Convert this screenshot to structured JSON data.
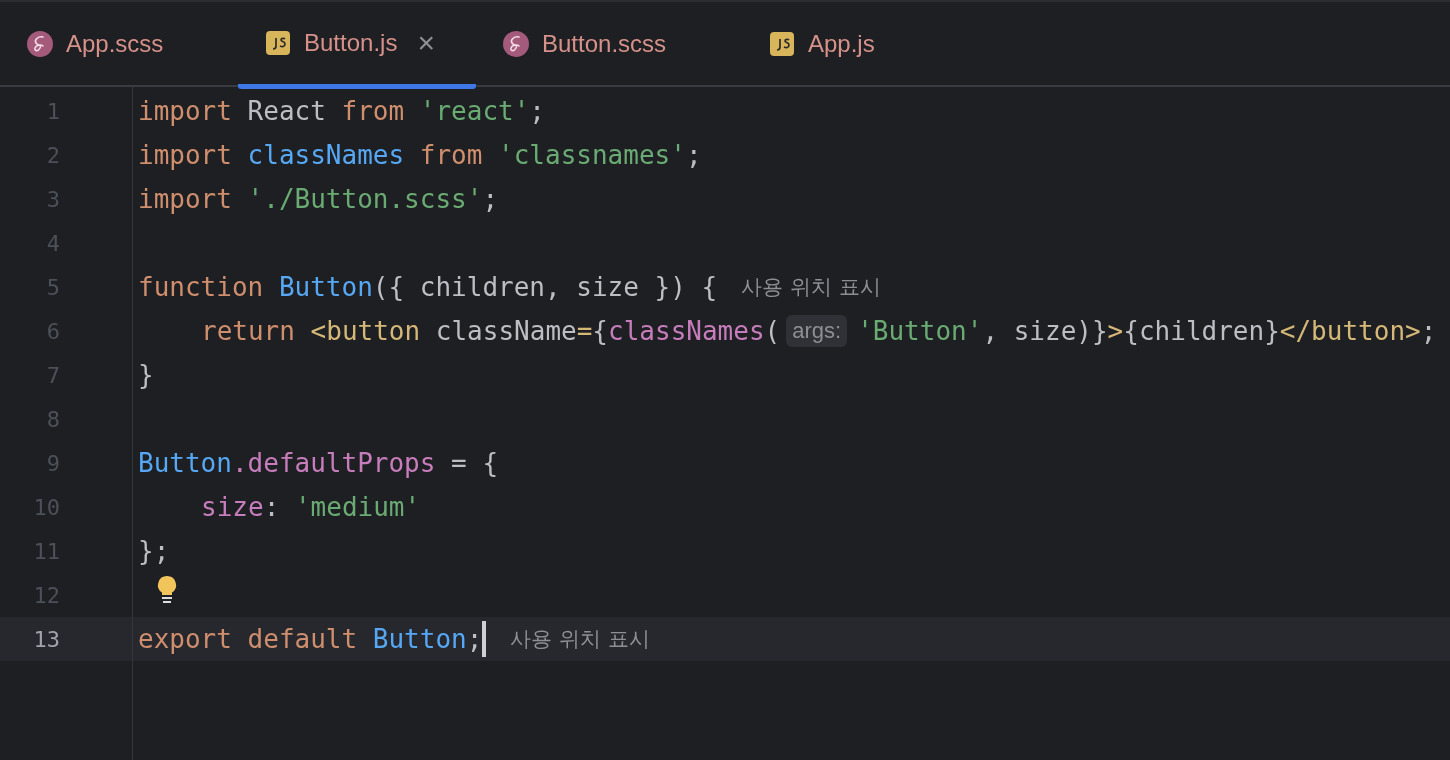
{
  "tabs": [
    {
      "label": "App.scss",
      "kind": "sass",
      "selected": false
    },
    {
      "label": "Button.js",
      "kind": "js",
      "selected": true
    },
    {
      "label": "Button.scss",
      "kind": "sass",
      "selected": false
    },
    {
      "label": "App.js",
      "kind": "js",
      "selected": false
    }
  ],
  "close_glyph": "×",
  "editor": {
    "lines": [
      {
        "number": "1",
        "current": false,
        "bulb": false,
        "caret": false,
        "indented": false,
        "segments": [
          {
            "kind": "code",
            "tokens": [
              {
                "kind": "kw",
                "s": "import "
              },
              {
                "kind": "id",
                "s": "React "
              },
              {
                "kind": "kw",
                "s": "from "
              },
              {
                "kind": "str",
                "s": "'react'"
              },
              {
                "kind": "id",
                "s": ";"
              }
            ]
          }
        ]
      },
      {
        "number": "2",
        "current": false,
        "bulb": false,
        "caret": false,
        "indented": false,
        "segments": [
          {
            "kind": "code",
            "tokens": [
              {
                "kind": "kw",
                "s": "import "
              },
              {
                "kind": "fn",
                "s": "classNames "
              },
              {
                "kind": "kw",
                "s": "from "
              },
              {
                "kind": "str",
                "s": "'classnames'"
              },
              {
                "kind": "id",
                "s": ";"
              }
            ]
          }
        ]
      },
      {
        "number": "3",
        "current": false,
        "bulb": false,
        "caret": false,
        "indented": false,
        "segments": [
          {
            "kind": "code",
            "tokens": [
              {
                "kind": "kw",
                "s": "import "
              },
              {
                "kind": "str",
                "s": "'./Button.scss'"
              },
              {
                "kind": "id",
                "s": ";"
              }
            ]
          }
        ]
      },
      {
        "number": "4",
        "current": false,
        "bulb": false,
        "caret": false
      },
      {
        "number": "5",
        "current": false,
        "bulb": false,
        "caret": false,
        "indented": false,
        "segments": [
          {
            "kind": "code",
            "tokens": [
              {
                "kind": "kw",
                "s": "function "
              },
              {
                "kind": "fn",
                "s": "Button"
              },
              {
                "kind": "id",
                "s": "({ children, size }) {"
              }
            ]
          },
          {
            "kind": "usage_hint",
            "text": "사용 위치 표시"
          }
        ]
      },
      {
        "number": "6",
        "current": false,
        "bulb": false,
        "caret": false,
        "indented": true,
        "segments": [
          {
            "kind": "code",
            "tokens": [
              {
                "kind": "kw",
                "s": "return "
              },
              {
                "kind": "tag",
                "s": "<button "
              },
              {
                "kind": "id",
                "s": "className"
              },
              {
                "kind": "tag",
                "s": "="
              },
              {
                "kind": "id",
                "s": "{"
              },
              {
                "kind": "prop",
                "s": "classNames"
              },
              {
                "kind": "id",
                "s": "("
              }
            ]
          },
          {
            "kind": "param_hint",
            "text": "args:"
          },
          {
            "kind": "code",
            "tokens": [
              {
                "kind": "str",
                "s": "'Button'"
              },
              {
                "kind": "id",
                "s": ", size)}"
              },
              {
                "kind": "tag",
                "s": ">"
              },
              {
                "kind": "id",
                "s": "{children}"
              },
              {
                "kind": "tag",
                "s": "</button>"
              },
              {
                "kind": "id",
                "s": ";"
              }
            ]
          }
        ]
      },
      {
        "number": "7",
        "current": false,
        "bulb": false,
        "caret": false,
        "indented": false,
        "segments": [
          {
            "kind": "code",
            "tokens": [
              {
                "kind": "id",
                "s": "}"
              }
            ]
          }
        ]
      },
      {
        "number": "8",
        "current": false,
        "bulb": false,
        "caret": false
      },
      {
        "number": "9",
        "current": false,
        "bulb": false,
        "caret": false,
        "indented": false,
        "segments": [
          {
            "kind": "code",
            "tokens": [
              {
                "kind": "fn",
                "s": "Button"
              },
              {
                "kind": "prop",
                "s": ".defaultProps"
              },
              {
                "kind": "id",
                "s": " = {"
              }
            ]
          }
        ]
      },
      {
        "number": "10",
        "current": false,
        "bulb": false,
        "caret": false,
        "indented": true,
        "segments": [
          {
            "kind": "code",
            "tokens": [
              {
                "kind": "prop",
                "s": "size"
              },
              {
                "kind": "id",
                "s": ": "
              },
              {
                "kind": "str",
                "s": "'medium'"
              }
            ]
          }
        ]
      },
      {
        "number": "11",
        "current": false,
        "bulb": false,
        "caret": false,
        "indented": false,
        "segments": [
          {
            "kind": "code",
            "tokens": [
              {
                "kind": "id",
                "s": "};"
              }
            ]
          }
        ]
      },
      {
        "number": "12",
        "current": false,
        "bulb": true,
        "caret": false
      },
      {
        "number": "13",
        "current": true,
        "bulb": false,
        "caret": true,
        "indented": false,
        "segments": [
          {
            "kind": "code",
            "tokens": [
              {
                "kind": "kw",
                "s": "export default "
              },
              {
                "kind": "fn",
                "s": "Button"
              },
              {
                "kind": "id",
                "s": ";"
              }
            ]
          },
          {
            "kind": "usage_hint",
            "text": "사용 위치 표시"
          }
        ]
      }
    ]
  }
}
